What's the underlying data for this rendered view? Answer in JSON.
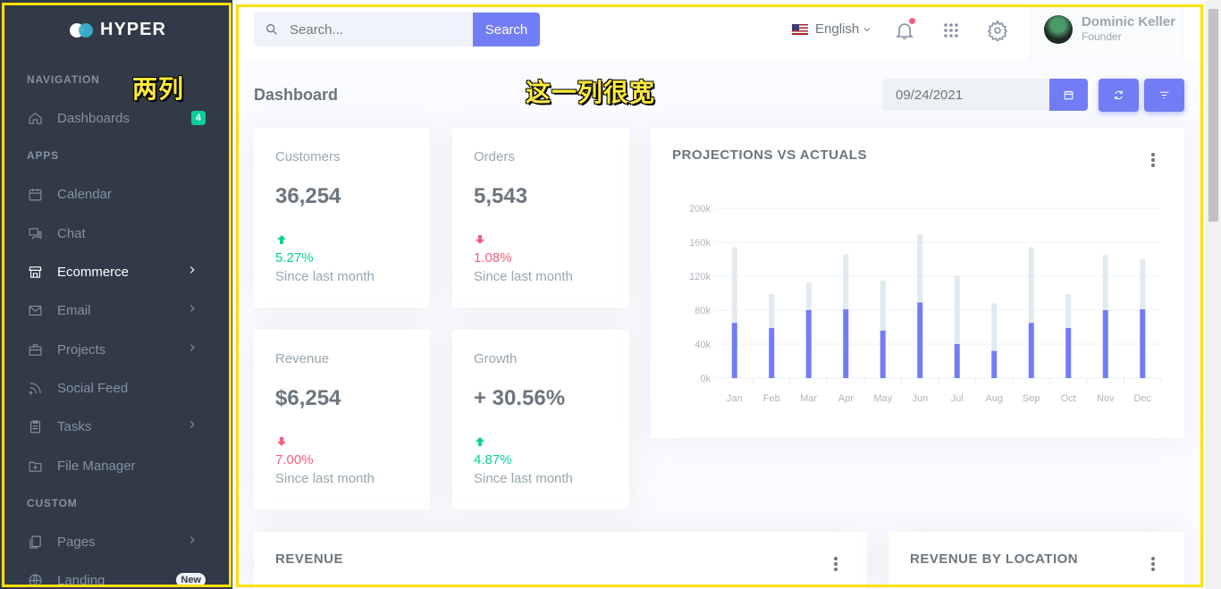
{
  "brand": {
    "name": "HYPER"
  },
  "sidebar": {
    "sections": [
      "NAVIGATION",
      "APPS",
      "CUSTOM"
    ],
    "items": [
      {
        "label": "Dashboards",
        "icon": "home-icon",
        "badge": "4"
      },
      {
        "label": "Calendar",
        "icon": "calendar-icon"
      },
      {
        "label": "Chat",
        "icon": "chat-icon"
      },
      {
        "label": "Ecommerce",
        "icon": "store-icon",
        "active": true
      },
      {
        "label": "Email",
        "icon": "mail-icon"
      },
      {
        "label": "Projects",
        "icon": "briefcase-icon"
      },
      {
        "label": "Social Feed",
        "icon": "rss-icon"
      },
      {
        "label": "Tasks",
        "icon": "clipboard-icon"
      },
      {
        "label": "File Manager",
        "icon": "folder-icon"
      },
      {
        "label": "Pages",
        "icon": "pages-icon"
      },
      {
        "label": "Landing",
        "icon": "globe-icon",
        "badge": "New"
      }
    ]
  },
  "annotations": {
    "left": "两列",
    "right": "这一列很宽"
  },
  "topbar": {
    "search_placeholder": "Search...",
    "search_button": "Search",
    "language": "English",
    "user_name": "Dominic Keller",
    "user_role": "Founder"
  },
  "page": {
    "title": "Dashboard",
    "date": "09/24/2021"
  },
  "stats": [
    {
      "label": "Customers",
      "value": "36,254",
      "pct": "5.27%",
      "trend": "up",
      "since": "Since last month"
    },
    {
      "label": "Orders",
      "value": "5,543",
      "pct": "1.08%",
      "trend": "down",
      "since": "Since last month"
    },
    {
      "label": "Revenue",
      "value": "$6,254",
      "pct": "7.00%",
      "trend": "down",
      "since": "Since last month"
    },
    {
      "label": "Growth",
      "value": "+ 30.56%",
      "pct": "4.87%",
      "trend": "up",
      "since": "Since last month"
    }
  ],
  "projections_card": {
    "title": "PROJECTIONS VS ACTUALS"
  },
  "revenue_card": {
    "title": "REVENUE"
  },
  "location_card": {
    "title": "REVENUE BY LOCATION"
  },
  "colors": {
    "primary": "#727cf5",
    "sidebar": "#313a46",
    "success": "#0acf97",
    "danger": "#fa5c7c",
    "projection": "#e3eaef"
  },
  "chart_data": {
    "type": "bar",
    "categories": [
      "Jan",
      "Feb",
      "Mar",
      "Apr",
      "May",
      "Jun",
      "Jul",
      "Aug",
      "Sep",
      "Oct",
      "Nov",
      "Dec"
    ],
    "series": [
      {
        "values": [
          65,
          59,
          80,
          81,
          56,
          89,
          40,
          32,
          65,
          59,
          80,
          81
        ]
      },
      {
        "values": [
          89,
          40,
          32,
          65,
          59,
          80,
          81,
          56,
          89,
          40,
          65,
          59
        ]
      }
    ],
    "stacked": true,
    "y_ticks": [
      "0k",
      "40k",
      "80k",
      "120k",
      "160k",
      "200k"
    ],
    "ylim": [
      0,
      200
    ],
    "title": "PROJECTIONS VS ACTUALS"
  }
}
